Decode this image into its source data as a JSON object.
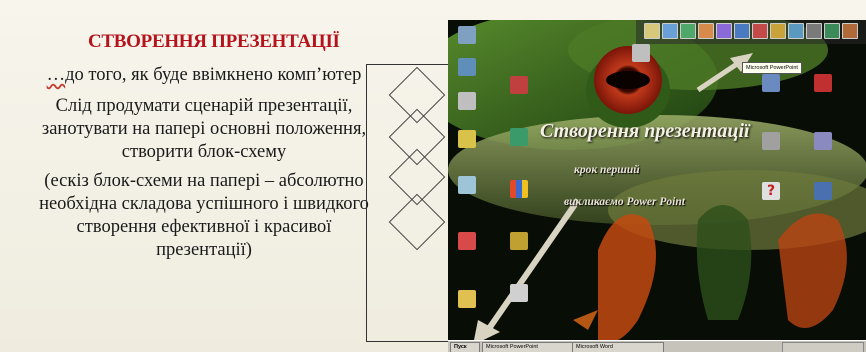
{
  "slide": {
    "title": "СТВОРЕННЯ ПРЕЗЕНТАЦІЇ",
    "intro_dots": "…",
    "intro_text": "до того, як буде ввімкнено комп’ютер",
    "paragraph": "Слід продумати сценарій презентації, занотувати на папері основні положення, створити блок-схему",
    "note": "(ескіз блок-схеми на папері – абсолютно необхідна складова успішного і швидкого створення ефективної і красивої презентації)"
  },
  "screenshot": {
    "overlay_title": "Створення презентації",
    "overlay_step": "крок перший",
    "overlay_call": "викликаємо Power Point",
    "tooltip": "Microsoft PowerPoint",
    "taskbar": {
      "start_label": "Пуск",
      "tasks": [
        "Microsoft PowerPoint",
        "Microsoft Word"
      ]
    }
  },
  "colors": {
    "title": "#b5121b",
    "slide_bg": "#f4f1e6",
    "overlay_text": "#f4f0e4",
    "arrow": "#d9d4c2"
  },
  "desktop_icons": [
    "my-computer-icon",
    "network-icon",
    "recycle-bin-icon",
    "briefcase-icon",
    "inbox-icon",
    "internet-explorer-icon",
    "folder-icon",
    "word-icon",
    "excel-icon",
    "powerpoint-icon",
    "help-icon",
    "calculator-icon",
    "paint-icon",
    "notepad-icon",
    "media-icon",
    "outlook-icon"
  ]
}
